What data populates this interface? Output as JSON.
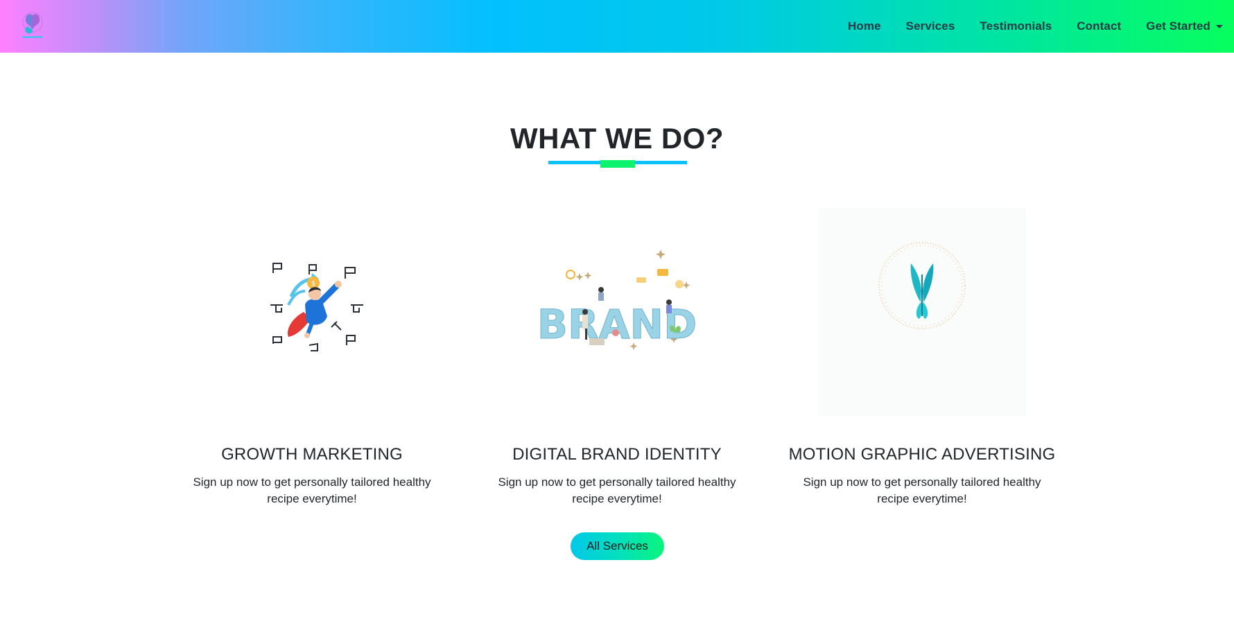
{
  "nav": {
    "links": [
      "Home",
      "Services",
      "Testimonials",
      "Contact",
      "Get Started"
    ]
  },
  "section": {
    "title": "WHAT WE DO?",
    "accent_blue": "#0ac2f7",
    "accent_green": "#0df36d"
  },
  "services": [
    {
      "title": "GROWTH MARKETING",
      "text": "Sign up now to get personally tailored healthy recipe everytime!",
      "image": "growth-marketing-illustration"
    },
    {
      "title": "DIGITAL BRAND IDENTITY",
      "text": "Sign up now to get personally tailored healthy recipe everytime!",
      "image": "brand-identity-illustration"
    },
    {
      "title": "MOTION GRAPHIC ADVERTISING",
      "text": "Sign up now to get personally tailored healthy recipe everytime!",
      "image": "butterfly-logo-illustration"
    }
  ],
  "cta": {
    "label": "All Services"
  },
  "colors": {
    "nav_text": "#2a3b45",
    "title_text": "#212529"
  }
}
